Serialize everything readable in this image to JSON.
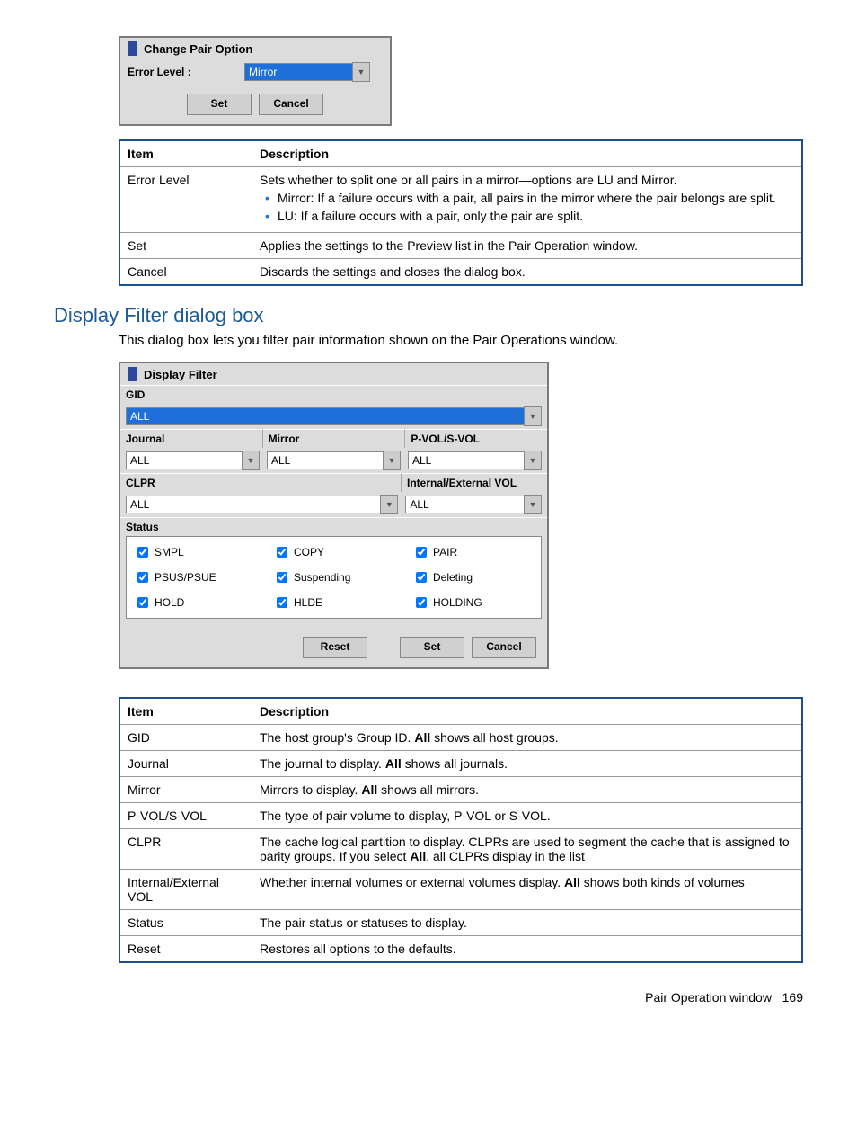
{
  "dialog1": {
    "title": "Change Pair Option",
    "label": "Error Level :",
    "value": "Mirror",
    "set": "Set",
    "cancel": "Cancel"
  },
  "table1": {
    "h1": "Item",
    "h2": "Description",
    "rows": [
      {
        "item": "Error Level",
        "desc": "Sets whether to split one or all pairs in a mirror—options are LU and Mirror.",
        "bullets": [
          "Mirror: If a failure occurs with a pair, all pairs in the mirror where the pair belongs are split.",
          "LU: If a failure occurs with a pair, only the pair are split."
        ]
      },
      {
        "item": "Set",
        "desc": "Applies the settings to the Preview list in the Pair Operation window."
      },
      {
        "item": "Cancel",
        "desc": "Discards the settings and closes the dialog box."
      }
    ]
  },
  "section": {
    "heading": "Display Filter dialog box",
    "para": "This dialog box lets you filter pair information shown on the Pair Operations window."
  },
  "dialog2": {
    "title": "Display Filter",
    "gid_label": "GID",
    "gid_value": "ALL",
    "journal_label": "Journal",
    "mirror_label": "Mirror",
    "pvol_label": "P-VOL/S-VOL",
    "journal_value": "ALL",
    "mirror_value": "ALL",
    "pvol_value": "ALL",
    "clpr_label": "CLPR",
    "ie_label": "Internal/External VOL",
    "clpr_value": "ALL",
    "ie_value": "ALL",
    "status_label": "Status",
    "checks": [
      "SMPL",
      "COPY",
      "PAIR",
      "PSUS/PSUE",
      "Suspending",
      "Deleting",
      "HOLD",
      "HLDE",
      "HOLDING"
    ],
    "reset": "Reset",
    "set": "Set",
    "cancel": "Cancel"
  },
  "table2": {
    "h1": "Item",
    "h2": "Description",
    "rows": [
      {
        "item": "GID",
        "desc_pre": "The host group's Group ID. ",
        "bold": "All",
        "desc_post": " shows all host groups."
      },
      {
        "item": "Journal",
        "desc_pre": "The journal to display. ",
        "bold": "All",
        "desc_post": " shows all journals."
      },
      {
        "item": "Mirror",
        "desc_pre": "Mirrors to display. ",
        "bold": "All",
        "desc_post": " shows all mirrors."
      },
      {
        "item": "P-VOL/S-VOL",
        "desc_plain": "The type of pair volume to display, P-VOL or S-VOL."
      },
      {
        "item": "CLPR",
        "desc_pre": "The cache logical partition to display. CLPRs are used to segment the cache that is assigned to parity groups. If you select ",
        "bold": "All",
        "desc_post": ", all CLPRs display in the list"
      },
      {
        "item": "Internal/External VOL",
        "desc_pre": "Whether internal volumes or external volumes display. ",
        "bold": "All",
        "desc_post": " shows both kinds of volumes"
      },
      {
        "item": "Status",
        "desc_plain": "The pair status or statuses to display."
      },
      {
        "item": "Reset",
        "desc_plain": "Restores all options to the defaults."
      }
    ]
  },
  "footer": {
    "label": "Pair Operation window",
    "page": "169"
  }
}
